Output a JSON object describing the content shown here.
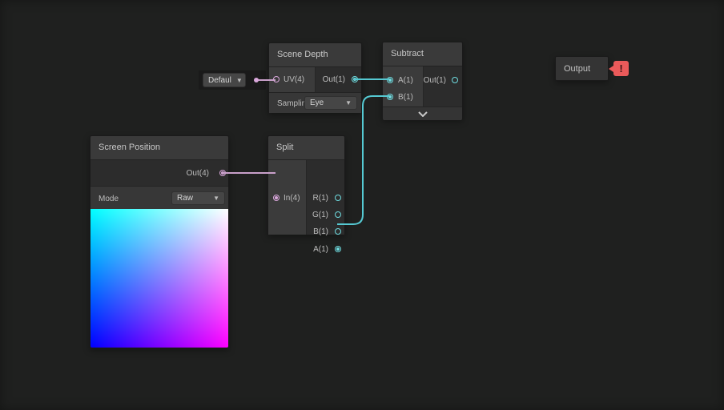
{
  "colors": {
    "canvas_bg": "#1f201f",
    "vector1_cyan": "#6fdce0",
    "vector4_pink": "#d9a7db",
    "edge_cyan": "#55c9d2",
    "edge_pink": "#c9a0ca",
    "error_red": "#ea5a5a"
  },
  "nodes": {
    "scene_depth": {
      "title": "Scene Depth",
      "ports": {
        "uv": "UV(4)",
        "out": "Out(1)"
      },
      "controls": {
        "sampling_label": "Samplin",
        "sampling_value": "Eye"
      }
    },
    "subtract": {
      "title": "Subtract",
      "ports": {
        "a": "A(1)",
        "b": "B(1)",
        "out": "Out(1)"
      }
    },
    "screen_position": {
      "title": "Screen Position",
      "ports": {
        "out": "Out(4)"
      },
      "controls": {
        "mode_label": "Mode",
        "mode_value": "Raw"
      }
    },
    "split": {
      "title": "Split",
      "ports": {
        "in": "In(4)",
        "r": "R(1)",
        "g": "G(1)",
        "b": "B(1)",
        "a": "A(1)"
      }
    },
    "output": {
      "title": "Output",
      "error_badge": "!"
    }
  },
  "inline_widget": {
    "value": "Defaul"
  }
}
